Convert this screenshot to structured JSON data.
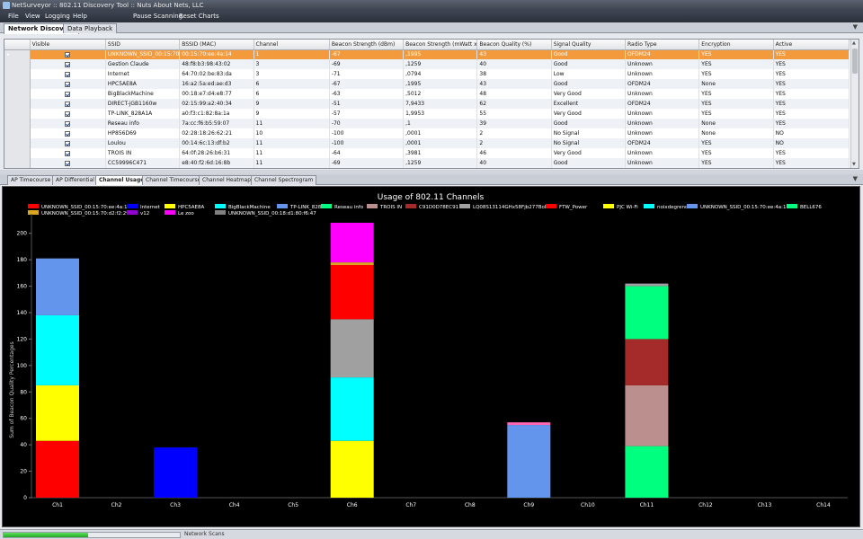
{
  "window": {
    "title": "NetSurveyor :: 802.11 Discovery Tool :: Nuts About Nets, LLC"
  },
  "menu": {
    "items": [
      "File",
      "View",
      "Logging",
      "Help",
      "Pause Scanning",
      "Reset Charts"
    ]
  },
  "top_tabs": [
    {
      "label": "Network Discovery",
      "active": true
    },
    {
      "label": "Data Playback",
      "active": false
    }
  ],
  "grid": {
    "columns": [
      "Visible",
      "SSID",
      "BSSID (MAC)",
      "Channel",
      "Beacon Strength (dBm)",
      "Beacon Strength (mWatt x...",
      "Beacon Quality (%)",
      "Signal Quality",
      "Radio Type",
      "Encryption",
      "Active"
    ],
    "rows": [
      {
        "ssid": "UNKNOWN_SSID_00:15:70:...",
        "bssid": "00:15:70:ee:4a:14",
        "channel": "1",
        "dbm": "-67",
        "mw": ",1995",
        "quality": "43",
        "signal": "Good",
        "radio": "OFDM24",
        "encryption": "YES",
        "active": "YES",
        "selected": true
      },
      {
        "ssid": "Gestion Claude",
        "bssid": "48:f8:b3:98:43:02",
        "channel": "3",
        "dbm": "-69",
        "mw": ",1259",
        "quality": "40",
        "signal": "Good",
        "radio": "Unknown",
        "encryption": "YES",
        "active": "YES"
      },
      {
        "ssid": "Internet",
        "bssid": "64:70:02:be:83:da",
        "channel": "3",
        "dbm": "-71",
        "mw": ",0794",
        "quality": "38",
        "signal": "Low",
        "radio": "Unknown",
        "encryption": "YES",
        "active": "YES"
      },
      {
        "ssid": "HPC5AE8A",
        "bssid": "16:a2:5a:ed:ae:d3",
        "channel": "6",
        "dbm": "-67",
        "mw": ",1995",
        "quality": "43",
        "signal": "Good",
        "radio": "OFDM24",
        "encryption": "None",
        "active": "YES"
      },
      {
        "ssid": "BigBlackMachine",
        "bssid": "00:18:e7:d4:e8:77",
        "channel": "6",
        "dbm": "-63",
        "mw": ",5012",
        "quality": "48",
        "signal": "Very Good",
        "radio": "Unknown",
        "encryption": "YES",
        "active": "YES"
      },
      {
        "ssid": "DIRECT-jGB1160w",
        "bssid": "02:15:99:a2:40:34",
        "channel": "9",
        "dbm": "-51",
        "mw": "7,9433",
        "quality": "62",
        "signal": "Excellent",
        "radio": "OFDM24",
        "encryption": "YES",
        "active": "YES"
      },
      {
        "ssid": "TP-LINK_828A1A",
        "bssid": "a0:f3:c1:82:8a:1a",
        "channel": "9",
        "dbm": "-57",
        "mw": "1,9953",
        "quality": "55",
        "signal": "Very Good",
        "radio": "Unknown",
        "encryption": "YES",
        "active": "YES"
      },
      {
        "ssid": "Reseau info",
        "bssid": "7a:cc:f6:b5:59:07",
        "channel": "11",
        "dbm": "-70",
        "mw": ",1",
        "quality": "39",
        "signal": "Good",
        "radio": "Unknown",
        "encryption": "None",
        "active": "YES"
      },
      {
        "ssid": "HP856D69",
        "bssid": "02:28:18:26:62:21",
        "channel": "10",
        "dbm": "-100",
        "mw": ",0001",
        "quality": "2",
        "signal": "No Signal",
        "radio": "Unknown",
        "encryption": "None",
        "active": "NO"
      },
      {
        "ssid": "Loulou",
        "bssid": "00:14:6c:13:df:b2",
        "channel": "11",
        "dbm": "-100",
        "mw": ",0001",
        "quality": "2",
        "signal": "No Signal",
        "radio": "OFDM24",
        "encryption": "YES",
        "active": "NO"
      },
      {
        "ssid": "TROIS IN",
        "bssid": "64:0f:28:26:b6:31",
        "channel": "11",
        "dbm": "-64",
        "mw": ",3981",
        "quality": "46",
        "signal": "Very Good",
        "radio": "Unknown",
        "encryption": "YES",
        "active": "YES"
      },
      {
        "ssid": "CC59996C471",
        "bssid": "e8:40:f2:6d:16:8b",
        "channel": "11",
        "dbm": "-69",
        "mw": ",1259",
        "quality": "40",
        "signal": "Good",
        "radio": "Unknown",
        "encryption": "YES",
        "active": "YES"
      }
    ]
  },
  "bottom_tabs": [
    {
      "label": "AP Timecourse",
      "active": false
    },
    {
      "label": "AP Differential",
      "active": false
    },
    {
      "label": "Channel Usage",
      "active": true
    },
    {
      "label": "Channel Timecourse",
      "active": false
    },
    {
      "label": "Channel Heatmap",
      "active": false
    },
    {
      "label": "Channel Spectrogram",
      "active": false
    }
  ],
  "status": {
    "label": "Network Scans",
    "progress": 0.48
  },
  "chart_data": {
    "type": "bar",
    "stacked": true,
    "title": "Usage of 802.11 Channels",
    "xlabel": "",
    "ylabel": "Sum of Beacon Quality Percentages",
    "ylim": [
      0,
      210
    ],
    "yticks": [
      0,
      20,
      40,
      60,
      80,
      100,
      120,
      140,
      160,
      180,
      200
    ],
    "categories": [
      "Ch1",
      "Ch2",
      "Ch3",
      "Ch4",
      "Ch5",
      "Ch6",
      "Ch7",
      "Ch8",
      "Ch9",
      "Ch10",
      "Ch11",
      "Ch12",
      "Ch13",
      "Ch14"
    ],
    "background": "#000000",
    "legend_position": "top-left",
    "legend": [
      {
        "name": "UNKNOWN_SSID_00:15:70:ee:4a:14",
        "color": "#ff0000"
      },
      {
        "name": "Internet",
        "color": "#0000ff"
      },
      {
        "name": "HPC5AE8A",
        "color": "#ffff00"
      },
      {
        "name": "BigBlackMachine",
        "color": "#00ffff"
      },
      {
        "name": "TP-LINK_828A1A",
        "color": "#6495ed"
      },
      {
        "name": "Reseau info",
        "color": "#00ff7f"
      },
      {
        "name": "TROIS IN",
        "color": "#bc8f8f"
      },
      {
        "name": "C91D0D78EC91",
        "color": "#a52a2a"
      },
      {
        "name": "LQ08S13114GHx58Fjb277BoP",
        "color": "#a0a0a0"
      },
      {
        "name": "FTW_Power",
        "color": "#ff0000"
      },
      {
        "name": "PJC Wi-Fi",
        "color": "#ffff00"
      },
      {
        "name": "noixdegrenoble",
        "color": "#00ffff"
      },
      {
        "name": "UNKNOWN_SSID_00:15:70:ee:4a:16",
        "color": "#6495ed"
      },
      {
        "name": "BELL676",
        "color": "#00ff7f"
      },
      {
        "name": "UNKNOWN_SSID_00:15:70:d2:f2:29",
        "color": "#daa520"
      },
      {
        "name": "v12",
        "color": "#9400d3"
      },
      {
        "name": "Le zoo",
        "color": "#ff00ff"
      },
      {
        "name": "UNKNOWN_SSID_00:18:d1:80:f6:47",
        "color": "#808080"
      }
    ],
    "stacks": [
      {
        "category": "Ch1",
        "segments": [
          {
            "value": 43,
            "color": "#ff0000"
          },
          {
            "value": 42,
            "color": "#ffff00"
          },
          {
            "value": 53,
            "color": "#00ffff"
          },
          {
            "value": 43,
            "color": "#6495ed"
          }
        ]
      },
      {
        "category": "Ch3",
        "segments": [
          {
            "value": 38,
            "color": "#0000ff"
          }
        ]
      },
      {
        "category": "Ch6",
        "segments": [
          {
            "value": 43,
            "color": "#ffff00"
          },
          {
            "value": 48,
            "color": "#00ffff"
          },
          {
            "value": 44,
            "color": "#a0a0a0"
          },
          {
            "value": 41,
            "color": "#ff0000"
          },
          {
            "value": 2,
            "color": "#daa520"
          },
          {
            "value": 30,
            "color": "#ff00ff"
          }
        ]
      },
      {
        "category": "Ch9",
        "segments": [
          {
            "value": 55,
            "color": "#6495ed"
          },
          {
            "value": 2,
            "color": "#ff69b4"
          }
        ]
      },
      {
        "category": "Ch11",
        "segments": [
          {
            "value": 39,
            "color": "#00ff7f"
          },
          {
            "value": 46,
            "color": "#bc8f8f"
          },
          {
            "value": 35,
            "color": "#a52a2a"
          },
          {
            "value": 40,
            "color": "#00ff7f"
          },
          {
            "value": 2,
            "color": "#a0a0a0"
          }
        ]
      }
    ]
  }
}
